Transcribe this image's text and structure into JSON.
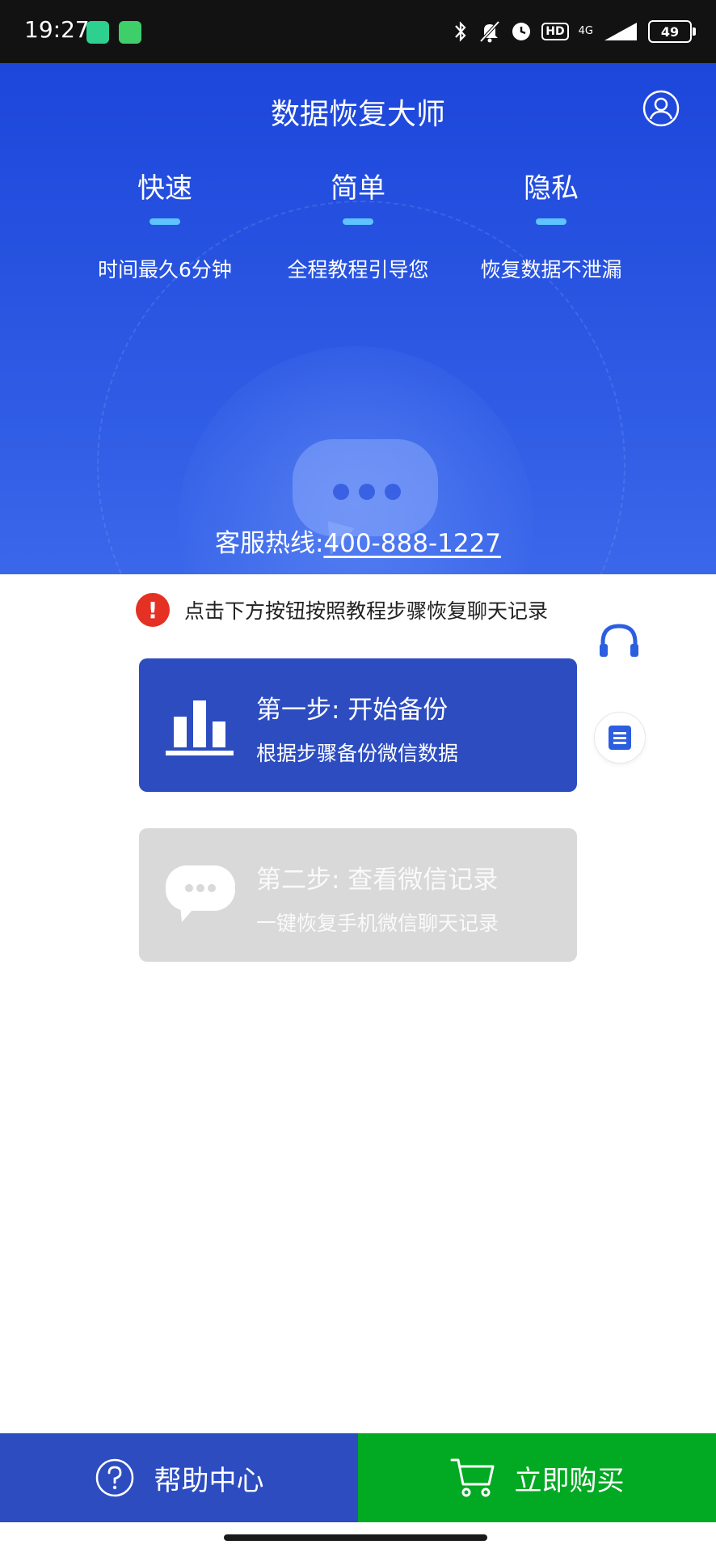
{
  "status_bar": {
    "time": "19:27",
    "hd_label": "HD",
    "network_label": "4G",
    "battery_level": "49"
  },
  "header": {
    "title": "数据恢复大师",
    "user_icon": "user-circle-icon"
  },
  "features": [
    {
      "title": "快速",
      "subtitle": "时间最久6分钟"
    },
    {
      "title": "简单",
      "subtitle": "全程教程引导您"
    },
    {
      "title": "隐私",
      "subtitle": "恢复数据不泄漏"
    }
  ],
  "hotline": {
    "label": "客服热线:",
    "number": "400-888-1227"
  },
  "notice": {
    "text": "点击下方按钮按照教程步骤恢复聊天记录",
    "icon": "alert-icon"
  },
  "steps": [
    {
      "title": "第一步: 开始备份",
      "subtitle": "根据步骤备份微信数据",
      "icon": "bar-chart-icon"
    },
    {
      "title": "第二步: 查看微信记录",
      "subtitle": "一键恢复手机微信聊天记录",
      "icon": "chat-bubble-icon"
    }
  ],
  "side_buttons": {
    "headset_icon": "headset-icon",
    "note_icon": "note-icon"
  },
  "bottom_bar": {
    "help_label": "帮助中心",
    "buy_label": "立即购买"
  },
  "colors": {
    "hero_blue": "#1d46db",
    "card_blue": "#2c4cc0",
    "buy_green": "#02a922",
    "alert_red": "#e53024",
    "accent_cyan": "#5ec3ff"
  }
}
